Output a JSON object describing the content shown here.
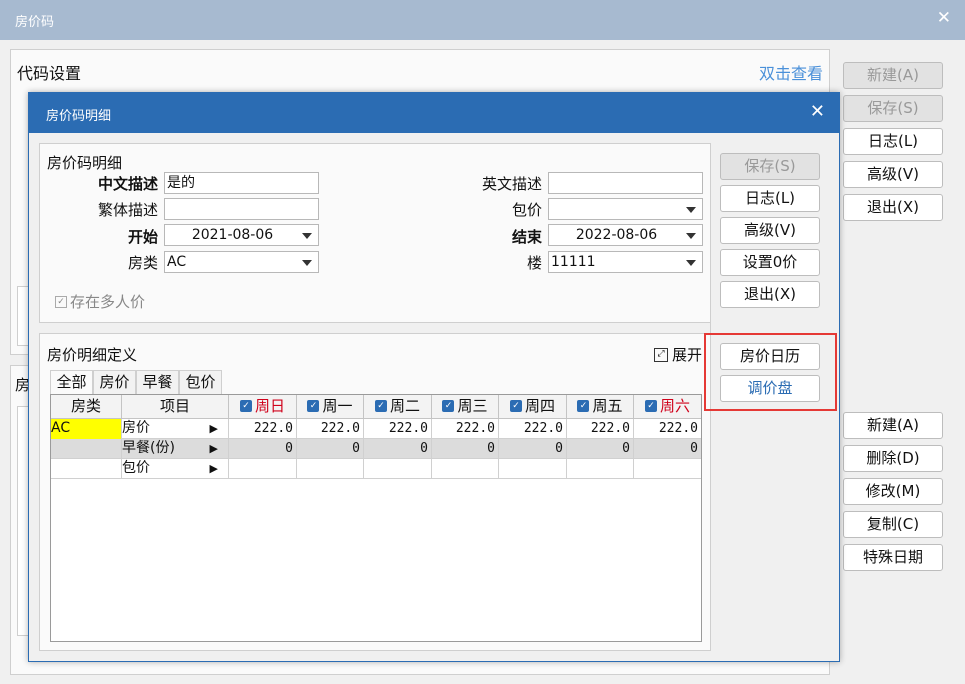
{
  "window": {
    "title": "房价码",
    "close_glyph": "✕"
  },
  "outer": {
    "panel_top_title": "代码设置",
    "double_click_link": "双击查看",
    "panel_bottom_title": "房",
    "buttons_top": [
      {
        "label": "新建(A)",
        "disabled": true
      },
      {
        "label": "保存(S)",
        "disabled": true
      },
      {
        "label": "日志(L)",
        "disabled": false
      },
      {
        "label": "高级(V)",
        "disabled": false
      },
      {
        "label": "退出(X)",
        "disabled": false
      }
    ],
    "buttons_bottom": [
      {
        "label": "新建(A)"
      },
      {
        "label": "删除(D)"
      },
      {
        "label": "修改(M)"
      },
      {
        "label": "复制(C)"
      },
      {
        "label": "特殊日期"
      }
    ]
  },
  "modal": {
    "title": "房价码明细",
    "close_glyph": "✕",
    "detail_section_title": "房价码明细",
    "fields": {
      "cn_desc_label": "中文描述",
      "cn_desc_value": "是的",
      "en_desc_label": "英文描述",
      "en_desc_value": "",
      "trad_desc_label": "繁体描述",
      "trad_desc_value": "",
      "package_label": "包价",
      "package_value": "",
      "start_label": "开始",
      "start_value": "2021-08-06",
      "end_label": "结束",
      "end_value": "2022-08-06",
      "room_type_label": "房类",
      "room_type_value": "AC",
      "floor_label": "楼",
      "floor_value": "11111",
      "multi_price_label": "存在多人价"
    },
    "side_buttons": [
      {
        "label": "保存(S)",
        "disabled": true
      },
      {
        "label": "日志(L)",
        "disabled": false
      },
      {
        "label": "高级(V)",
        "disabled": false
      },
      {
        "label": "设置0价",
        "disabled": false
      },
      {
        "label": "退出(X)",
        "disabled": false
      }
    ],
    "rate_section_title": "房价明细定义",
    "expand_label": "展开",
    "tabs": [
      "全部",
      "房价",
      "早餐",
      "包价"
    ],
    "grid": {
      "headers": [
        "房类",
        "项目",
        "周日",
        "周一",
        "周二",
        "周三",
        "周四",
        "周五",
        "周六"
      ],
      "rows": [
        {
          "room": "AC",
          "item": "房价",
          "values": [
            "222.0",
            "222.0",
            "222.0",
            "222.0",
            "222.0",
            "222.0",
            "222.0"
          ]
        },
        {
          "room": "",
          "item": "早餐(份)",
          "values": [
            "0",
            "0",
            "0",
            "0",
            "0",
            "0",
            "0"
          ]
        },
        {
          "room": "",
          "item": "包价",
          "values": [
            "",
            "",
            "",
            "",
            "",
            "",
            ""
          ]
        }
      ]
    },
    "calendar_button": "房价日历",
    "adjust_button": "调价盘"
  },
  "colors": {
    "accent": "#2b6cb3",
    "weekend": "#d0021b",
    "highlight": "#e53935",
    "selected_cell": "#ffff00"
  }
}
